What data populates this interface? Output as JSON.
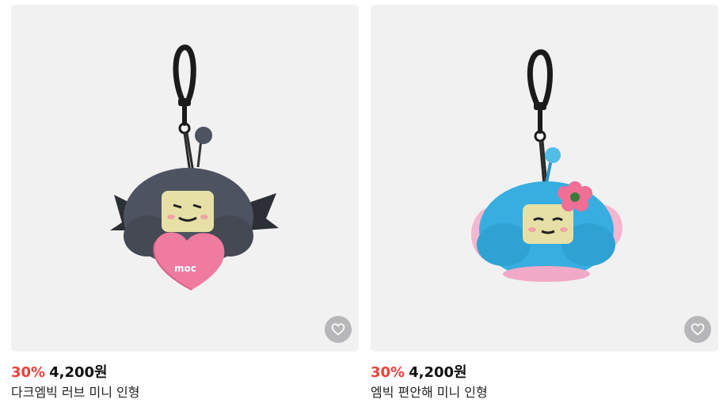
{
  "products": [
    {
      "name": "다크엠빅 러브 미니 인형",
      "discount": "30%",
      "price": "4,200원",
      "image_icon": "plush-keyring-dark",
      "wishlist_icon": "heart-outline-icon",
      "colors": {
        "body": "#4d5360",
        "heart": "#f07ba0"
      }
    },
    {
      "name": "엠빅 편안해 미니 인형",
      "discount": "30%",
      "price": "4,200원",
      "image_icon": "plush-keyring-blue",
      "wishlist_icon": "heart-outline-icon",
      "colors": {
        "body": "#38aee0",
        "flower": "#ef6f95"
      }
    }
  ],
  "colors": {
    "discount": "#ef3e39",
    "thumb_bg": "#f1f1f2",
    "wish_bg": "#b7b7b9"
  }
}
